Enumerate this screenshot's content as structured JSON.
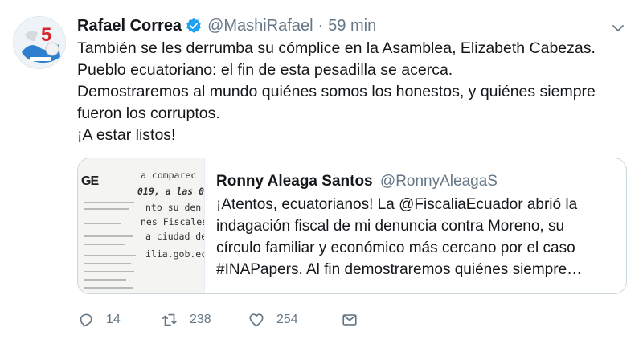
{
  "tweet": {
    "name": "Rafael Correa",
    "handle": "@MashiRafael",
    "separator": "·",
    "time": "59 min",
    "lines": [
      "También se les derrumba su cómplice en la Asamblea, Elizabeth Cabezas.",
      "Pueblo ecuatoriano: el fin de esta pesadilla se acerca.",
      "Demostraremos al mundo quiénes somos los honestos, y quiénes siempre",
      "fueron los corruptos.",
      "¡A estar listos!"
    ]
  },
  "quoted": {
    "name": "Ronny Aleaga Santos",
    "handle": "@RonnyAleagaS",
    "lines": [
      "¡Atentos, ecuatorianos! La @FiscaliaEcuador abrió la",
      "indagación fiscal de mi denuncia contra Moreno, su",
      "círculo familiar y económico más cercano por el caso",
      "#INAPapers. Al fin demostraremos quiénes siempre…"
    ],
    "thumbnail_text": {
      "logo": "GE",
      "l1": "a comparec",
      "l2": "019, a las 0",
      "l3": "nto su den",
      "l4": "nes Fiscales",
      "l5": "a ciudad de",
      "l6": "ilia.gob.ec"
    }
  },
  "actions": {
    "replies": "14",
    "retweets": "238",
    "likes": "254"
  },
  "colors": {
    "text": "#14171a",
    "muted": "#657786",
    "border": "#ccd6dd",
    "verified": "#1da1f2"
  },
  "icons": [
    "verified-badge-icon",
    "chevron-down-icon",
    "reply-icon",
    "retweet-icon",
    "like-icon",
    "direct-message-icon"
  ]
}
